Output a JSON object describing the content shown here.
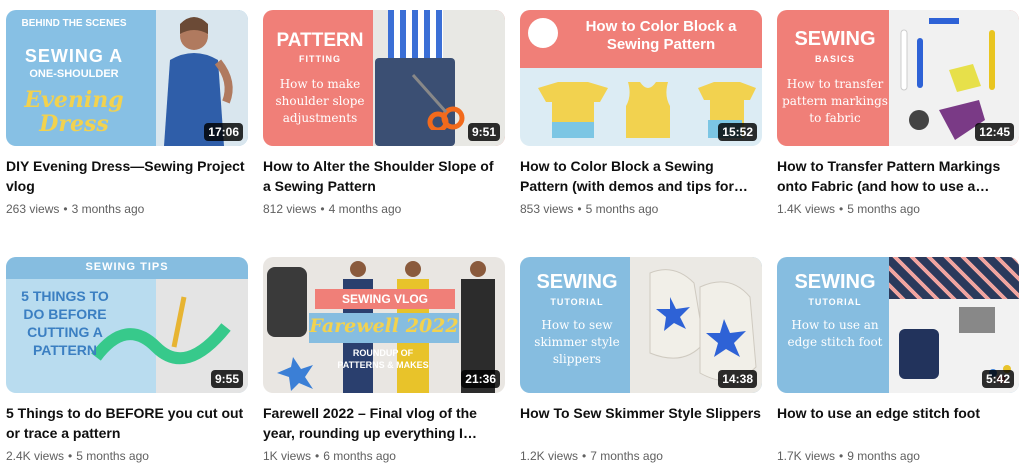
{
  "videos": [
    {
      "title": "DIY Evening Dress—Sewing Project vlog",
      "duration": "17:06",
      "views": "263 views",
      "age": "3 months ago",
      "thumb": {
        "line1": "BEHIND THE SCENES",
        "line2": "SEWING A",
        "line3": "ONE-SHOULDER",
        "script": "Evening Dress"
      }
    },
    {
      "title": "How to Alter the Shoulder Slope of a Sewing Pattern",
      "duration": "9:51",
      "views": "812 views",
      "age": "4 months ago",
      "thumb": {
        "heading": "PATTERN",
        "sub": "FITTING",
        "body": "How to make shoulder slope adjustments"
      }
    },
    {
      "title": "How to Color Block a Sewing Pattern (with demos and tips for…",
      "duration": "15:52",
      "views": "853 views",
      "age": "5 months ago",
      "thumb": {
        "heading": "How to Color Block a Sewing Pattern"
      }
    },
    {
      "title": "How to Transfer Pattern Markings onto Fabric (and how to use a…",
      "duration": "12:45",
      "views": "1.4K views",
      "age": "5 months ago",
      "thumb": {
        "heading": "SEWING",
        "sub": "BASICS",
        "body": "How to transfer pattern markings to fabric"
      }
    },
    {
      "title": "5 Things to do BEFORE you cut out or trace a pattern",
      "duration": "9:55",
      "views": "2.4K views",
      "age": "5 months ago",
      "thumb": {
        "heading": "SEWING TIPS",
        "body": "5 THINGS TO DO BEFORE CUTTING A PATTERN"
      }
    },
    {
      "title": "Farewell 2022 – Final vlog of the year, rounding up everything I mad…",
      "duration": "21:36",
      "views": "1K views",
      "age": "6 months ago",
      "thumb": {
        "heading": "SEWING VLOG",
        "script": "Farewell 2022",
        "body": "ROUNDUP OF PATTERNS & MAKES"
      }
    },
    {
      "title": "How To Sew Skimmer Style Slippers",
      "duration": "14:38",
      "views": "1.2K views",
      "age": "7 months ago",
      "thumb": {
        "heading": "SEWING",
        "sub": "TUTORIAL",
        "body": "How to sew skimmer style slippers"
      }
    },
    {
      "title": "How to use an edge stitch foot",
      "duration": "5:42",
      "views": "1.7K views",
      "age": "9 months ago",
      "thumb": {
        "heading": "SEWING",
        "sub": "TUTORIAL",
        "body": "How to use an edge stitch foot"
      }
    }
  ],
  "colors": {
    "coral": "#f07f78",
    "blue": "#86bde0",
    "mustard": "#e8c94a",
    "duration_bg": "#000000cc"
  }
}
